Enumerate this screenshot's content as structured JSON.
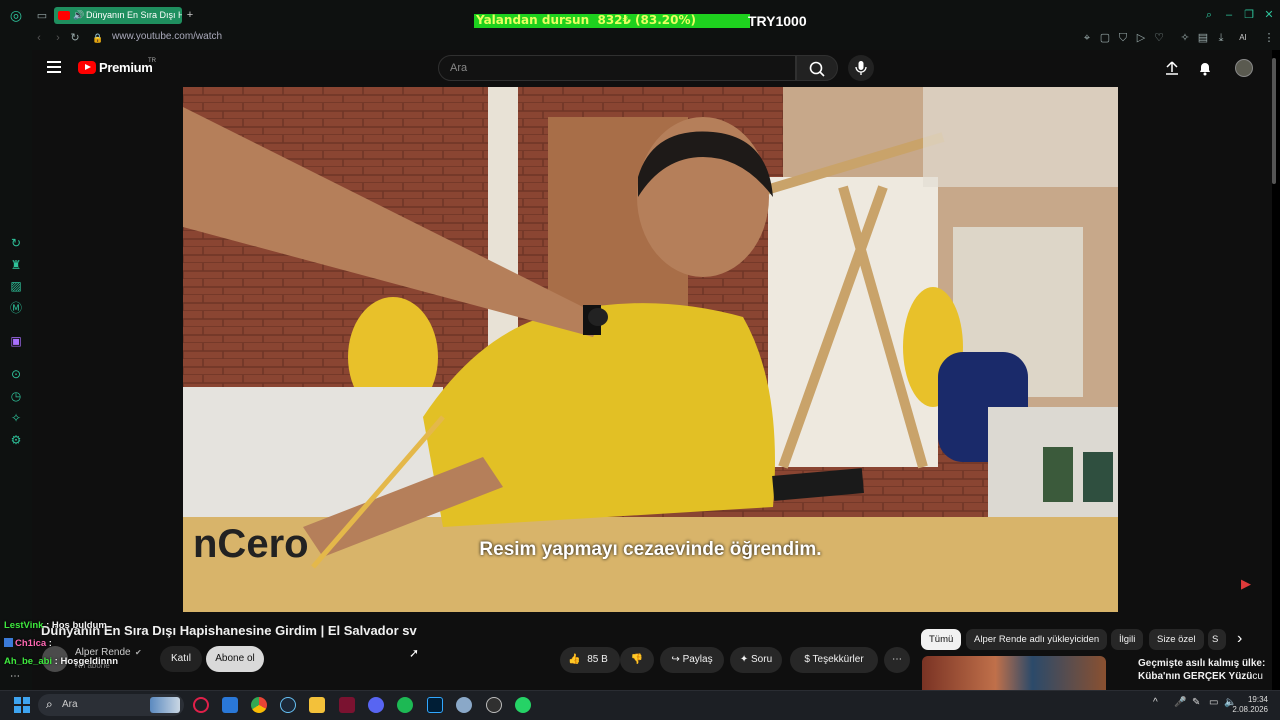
{
  "browser": {
    "tab_title": "Dünyanın En Sıra Dışı H",
    "url": "www.youtube.com/watch",
    "new_tab": "+",
    "ai_label": "AI"
  },
  "overlay": {
    "bar_text": "Yalandan dursun  832₺ (83.20%)",
    "goal_text": "TRY1000",
    "progress_percent": 83.2
  },
  "youtube": {
    "logo_text": "Premium",
    "region": "TR",
    "search_placeholder": "Ara",
    "subtitle": "Resim yapmayı cezaevinde öğrendim.",
    "video_title": "Dünyanın En Sıra Dışı Hapishanesine Girdim | El Salvador sv",
    "channel_name": "Alper Rende",
    "subscribers": "Nn abone",
    "join_label": "Katıl",
    "subscribe_label": "Abone ol",
    "likes": "85 B",
    "share_label": "Paylaş",
    "ask_label": "Soru",
    "thanks_label": "Teşekkürler",
    "chips": [
      "Tümü",
      "Alper Rende adlı yükleyiciden",
      "İlgili",
      "Size özel",
      "S"
    ],
    "rec_title_line1": "Geçmişte asılı kalmış ülke:",
    "rec_title_line2": "Küba'nın GERÇEK Yüzü",
    "rec_title_tail": "cu"
  },
  "chat": [
    {
      "user": "LestVink",
      "message": "Hoş buldum",
      "color": "#3ee83e"
    },
    {
      "user": "Ch1ica",
      "message": "",
      "color": "#ff69b4"
    },
    {
      "user": "Ah_be_abi",
      "message": "Hoşgeldinnn",
      "color": "#3ee83e"
    }
  ],
  "taskbar": {
    "search_label": "Ara",
    "time": "19:34",
    "date": "2.08.2026"
  },
  "colors": {
    "accent": "#1f8f5f",
    "youtube_red": "#ff0000",
    "overlay_green": "#1ed11e"
  }
}
